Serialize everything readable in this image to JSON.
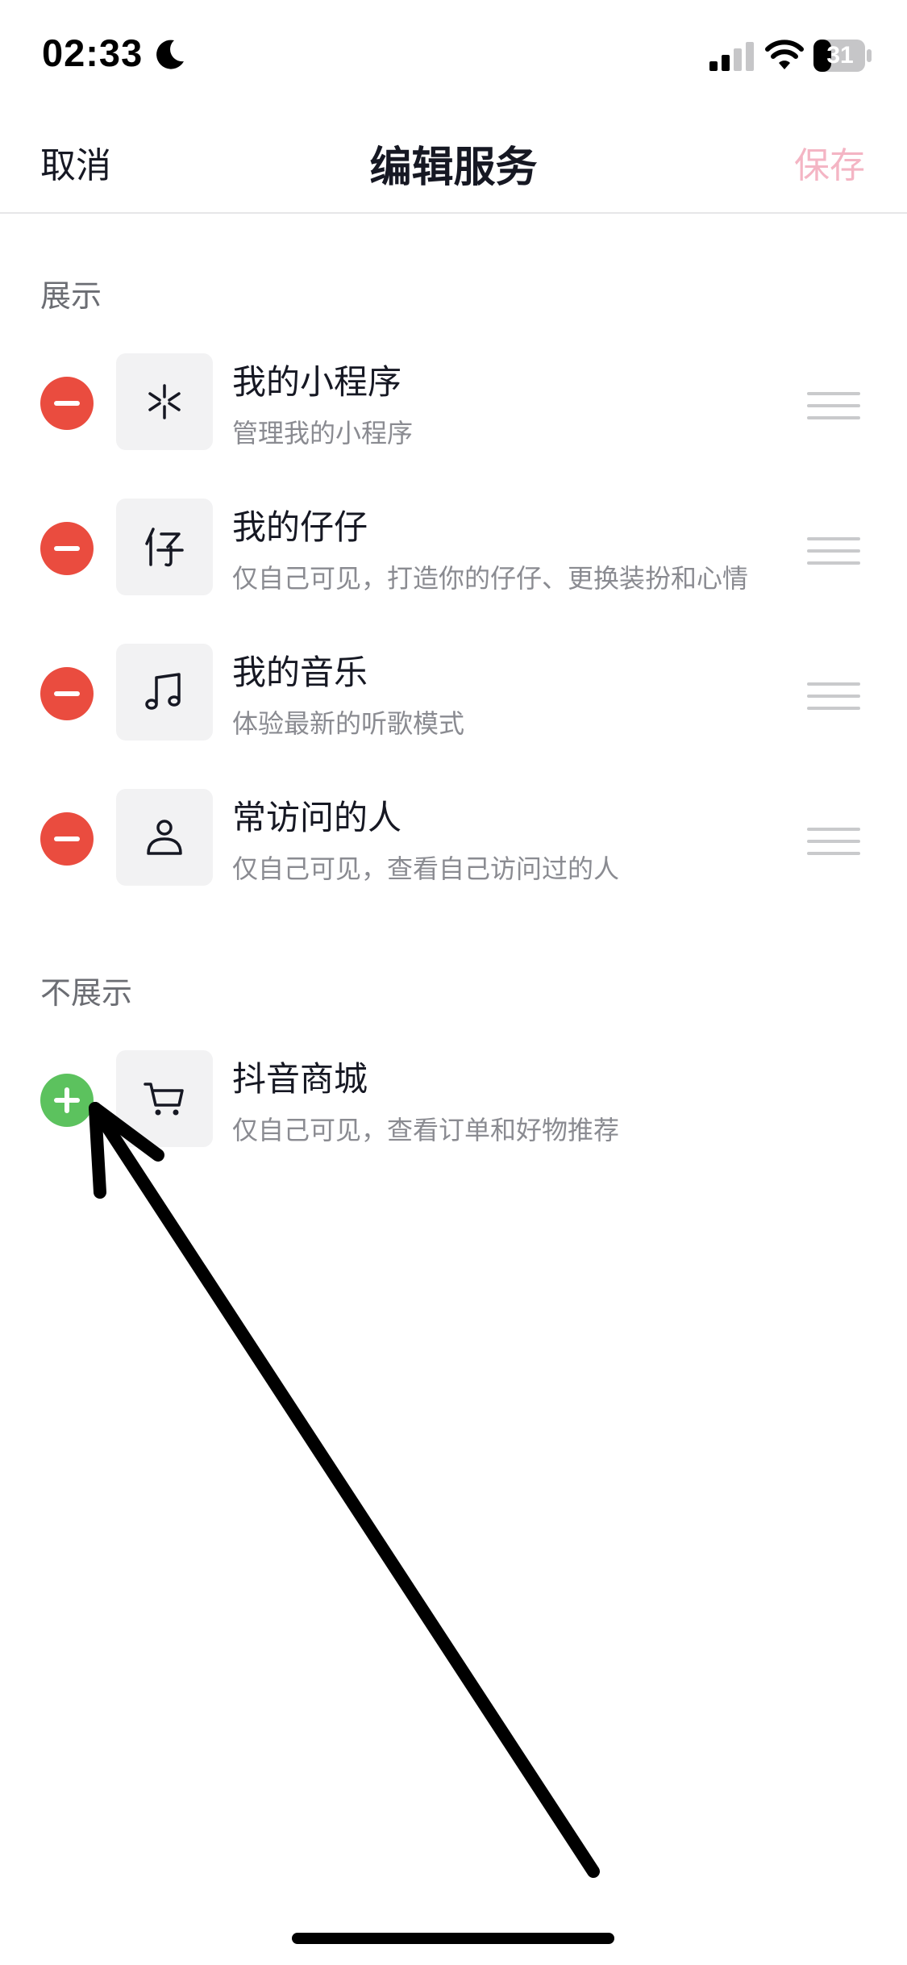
{
  "status_bar": {
    "time": "02:33",
    "battery": "31",
    "icons": [
      "moon-icon",
      "signal-icon",
      "wifi-icon",
      "battery-icon"
    ]
  },
  "nav": {
    "cancel_label": "取消",
    "title": "编辑服务",
    "save_label": "保存"
  },
  "shown_section": {
    "header": "展示",
    "items": [
      {
        "title": "我的小程序",
        "subtitle": "管理我的小程序",
        "icon": "mini-program-icon"
      },
      {
        "title": "我的仔仔",
        "subtitle": "仅自己可见，打造你的仔仔、更换装扮和心情",
        "icon": "zaizai-icon"
      },
      {
        "title": "我的音乐",
        "subtitle": "体验最新的听歌模式",
        "icon": "music-note-icon"
      },
      {
        "title": "常访问的人",
        "subtitle": "仅自己可见，查看自己访问过的人",
        "icon": "person-icon"
      }
    ]
  },
  "hidden_section": {
    "header": "不展示",
    "items": [
      {
        "title": "抖音商城",
        "subtitle": "仅自己可见，查看订单和好物推荐",
        "icon": "shopping-cart-icon"
      }
    ]
  },
  "colors": {
    "remove": "#ea4c3f",
    "add": "#5cc25e",
    "save_disabled": "#f4b5c4",
    "text_primary": "#161823",
    "text_secondary": "#8a8b91"
  }
}
